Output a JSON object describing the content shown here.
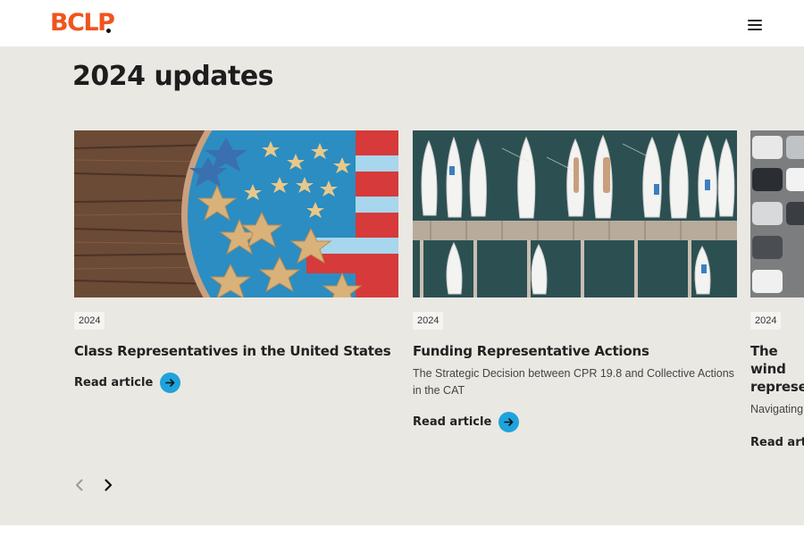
{
  "header": {
    "logo_text": "BCLP",
    "menu_icon": "hamburger-menu-icon"
  },
  "section": {
    "title": "2024 updates"
  },
  "cards": [
    {
      "year": "2024",
      "title": "Class Representatives in the United States",
      "description": "",
      "read_label": "Read article",
      "image": "cookies-flag-image"
    },
    {
      "year": "2024",
      "title": "Funding Representative Actions",
      "description": "The Strategic Decision between CPR 19.8 and Collective Actions in the CAT",
      "read_label": "Read article",
      "image": "marina-boats-image"
    },
    {
      "year": "2024",
      "title": "The wind represe",
      "description": "Navigating",
      "read_label": "Read artic",
      "image": "parking-cars-image"
    }
  ],
  "carousel": {
    "prev_icon": "chevron-left-icon",
    "next_icon": "chevron-right-icon"
  },
  "colors": {
    "brand": "#f0541e",
    "accent": "#1fa3dc",
    "background": "#eae8e3"
  }
}
